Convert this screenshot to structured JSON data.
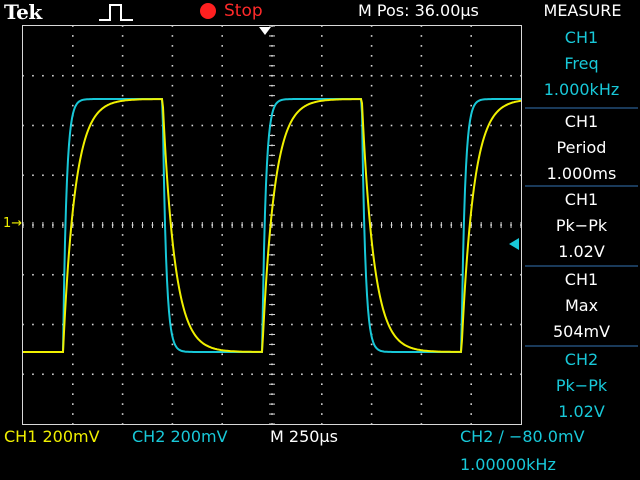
{
  "header": {
    "brand": "Tek",
    "run_state": "Stop",
    "m_pos": "M Pos: 36.00µs",
    "measure_title": "MEASURE"
  },
  "measurements": [
    {
      "channel": "CH1",
      "name": "Freq",
      "value": "1.000kHz",
      "color": "#18c8d8"
    },
    {
      "channel": "CH1",
      "name": "Period",
      "value": "1.000ms",
      "color": "#ffffff"
    },
    {
      "channel": "CH1",
      "name": "Pk−Pk",
      "value": "1.02V",
      "color": "#ffffff"
    },
    {
      "channel": "CH1",
      "name": "Max",
      "value": "504mV",
      "color": "#ffffff"
    },
    {
      "channel": "CH2",
      "name": "Pk−Pk",
      "value": "1.02V",
      "color": "#18c8d8"
    }
  ],
  "footer": {
    "ch1_scale": "CH1  200mV",
    "ch2_scale": "CH2  200mV",
    "timebase": "M 250µs",
    "trigger": "CH2 ∕ −80.0mV",
    "trigger_freq": "1.00000kHz"
  },
  "markers": {
    "ch1": "1→"
  },
  "colors": {
    "ch1": "#f0f000",
    "ch2": "#18c8d8",
    "stop": "#ff2020",
    "grid": "#d8d8d8"
  }
}
